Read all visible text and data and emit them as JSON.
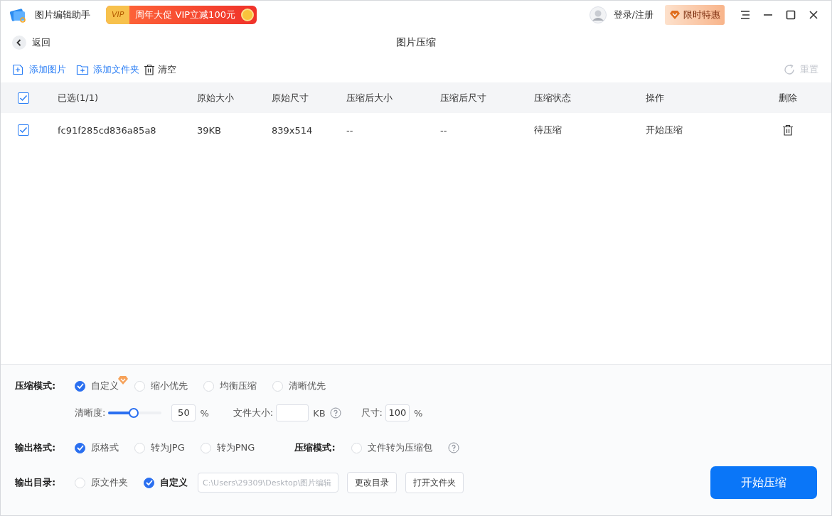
{
  "app": {
    "title": "图片编辑助手",
    "promo": "周年大促 VIP立减100元",
    "promo_badge": "VIP"
  },
  "header": {
    "login": "登录/注册",
    "offer": "限时特惠"
  },
  "nav": {
    "back": "返回",
    "title": "图片压缩"
  },
  "toolbar": {
    "actions": [
      {
        "kind": "add-image",
        "label": "添加图片"
      },
      {
        "kind": "add-folder",
        "label": "添加文件夹"
      },
      {
        "kind": "clear",
        "label": "清空"
      }
    ],
    "reset": {
      "label": "重置",
      "disabled": true
    }
  },
  "table": {
    "all_checked": true,
    "columns": [
      "已选(1/1)",
      "原始大小",
      "原始尺寸",
      "压缩后大小",
      "压缩后尺寸",
      "压缩状态",
      "操作",
      "删除"
    ],
    "rows": [
      {
        "checked": true,
        "cells": [
          "fc91f285cd836a85a8",
          "39KB",
          "839x514",
          "--",
          "--",
          "待压缩",
          "开始压缩"
        ]
      }
    ]
  },
  "settings": {
    "mode": {
      "label": "压缩模式:",
      "options": [
        {
          "label": "自定义",
          "selected": true,
          "premium": true
        },
        {
          "label": "缩小优先",
          "selected": false,
          "premium": false
        },
        {
          "label": "均衡压缩",
          "selected": false,
          "premium": false
        },
        {
          "label": "清晰优先",
          "selected": false,
          "premium": false
        }
      ]
    },
    "quality": {
      "label": "清晰度:",
      "level": 0.48,
      "value": "50",
      "unit": "%"
    },
    "file_size": {
      "label": "文件大小:",
      "unit": "KB"
    },
    "dimension": {
      "label": "尺寸:",
      "value": "100",
      "unit": "%"
    },
    "format": {
      "label": "输出格式:",
      "options": [
        {
          "label": "原格式",
          "selected": true
        },
        {
          "label": "转为JPG",
          "selected": false
        },
        {
          "label": "转为PNG",
          "selected": false
        }
      ]
    },
    "archive": {
      "label": "压缩模式:",
      "option": {
        "label": "文件转为压缩包",
        "selected": false
      }
    },
    "output": {
      "label": "输出目录:",
      "emphasize_selected": true,
      "options": [
        {
          "label": "原文件夹",
          "selected": false
        },
        {
          "label": "自定义",
          "selected": true
        }
      ],
      "path": "C:\\Users\\29309\\Desktop\\图片编辑",
      "buttons": [
        "更改目录",
        "打开文件夹"
      ]
    },
    "start": "开始压缩"
  }
}
